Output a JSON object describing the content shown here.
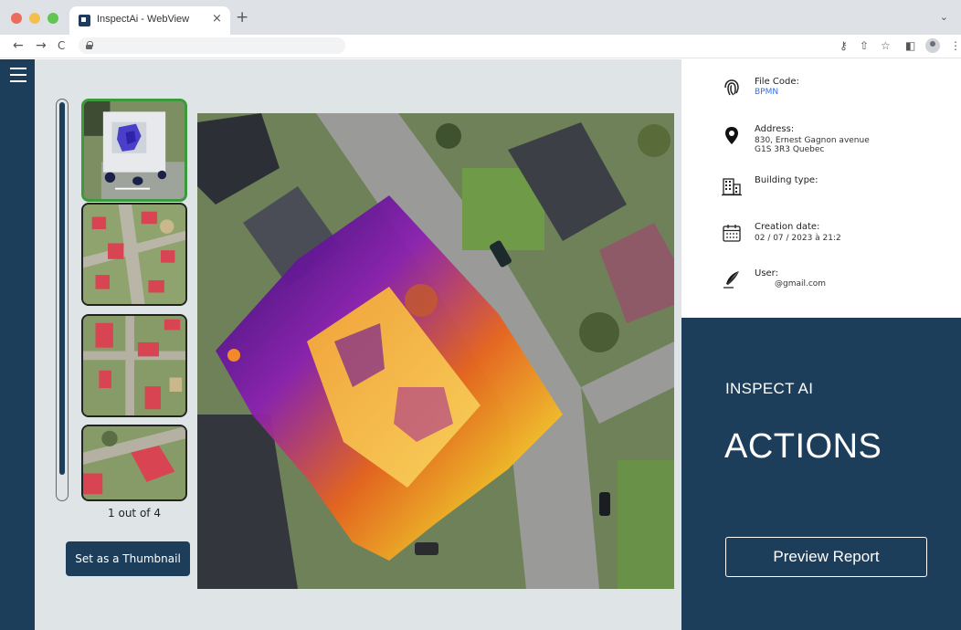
{
  "browser": {
    "tab_title": "InspectAi - WebView",
    "tab_close": "×",
    "new_tab": "+",
    "nav_back": "←",
    "nav_forward": "→",
    "nav_reload": "C"
  },
  "thumbnails": {
    "counter": "1 out of 4",
    "set_thumbnail_label": "Set as a Thumbnail"
  },
  "file_info": {
    "file_code_label": "File Code:",
    "file_code_value": "BPMN",
    "address_label": "Address:",
    "address_line1": "830, Ernest Gagnon avenue",
    "address_line2": "G1S 3R3 Quebec",
    "building_type_label": "Building type:",
    "creation_date_label": "Creation date:",
    "creation_date_value": "02 / 07 / 2023 à 21:2",
    "user_label": "User:",
    "user_value": "@gmail.com"
  },
  "actions": {
    "brand": "INSPECT AI",
    "title": "ACTIONS",
    "preview_label": "Preview Report"
  },
  "colors": {
    "brand_navy": "#1d3e5a",
    "selected_thumbnail": "#3c9a3c",
    "link_blue": "#3a6fd8"
  }
}
